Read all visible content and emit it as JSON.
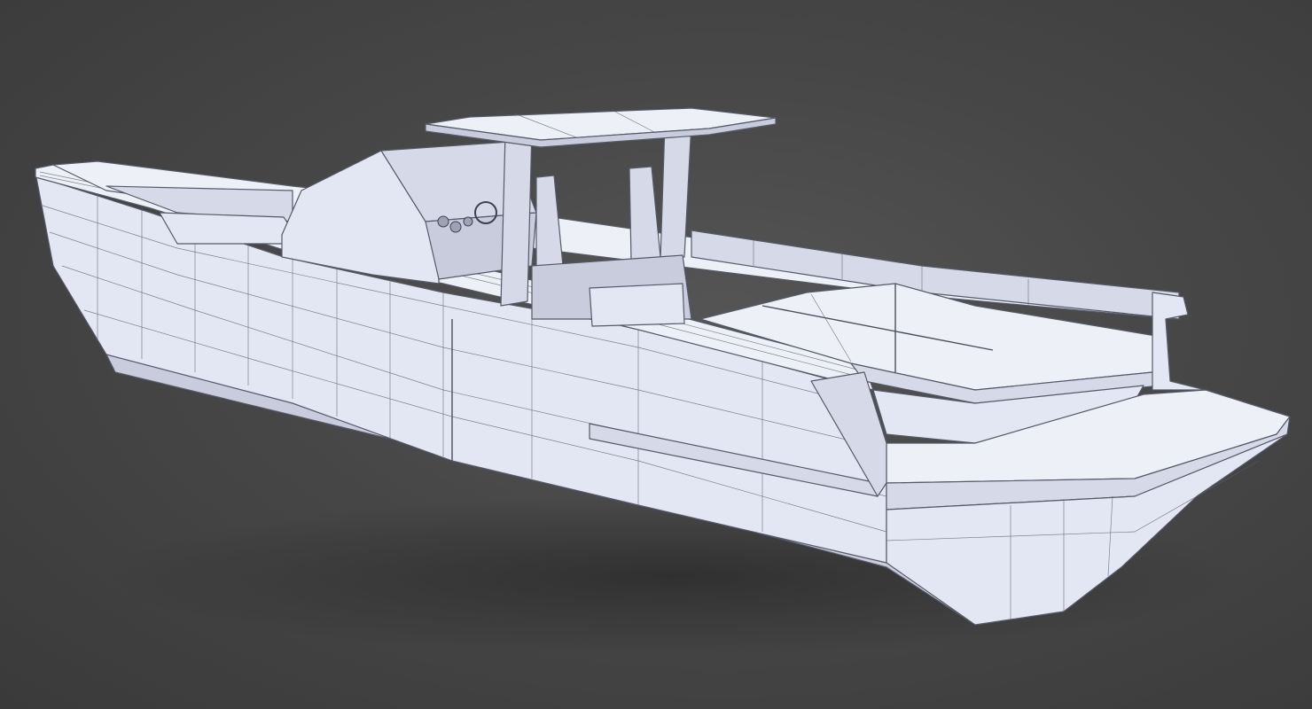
{
  "scene": {
    "subject": "boat-3d-wireframe-model",
    "background_color": "#474747",
    "model_color": "#e3e6f3",
    "wire_color": "#555a68"
  }
}
